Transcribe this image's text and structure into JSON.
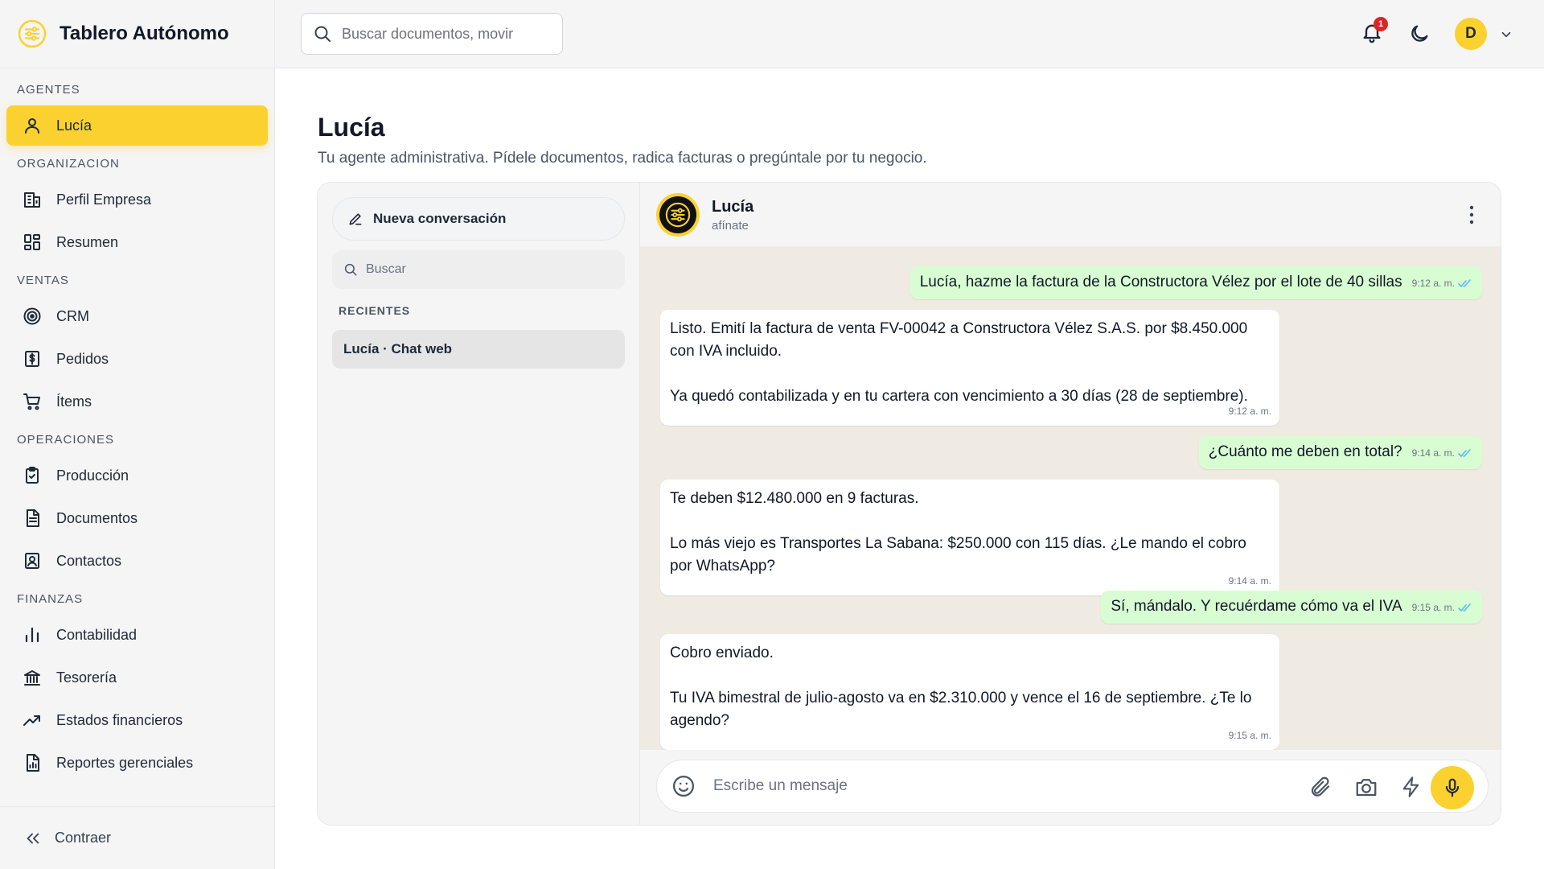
{
  "app": {
    "title": "Tablero Autónomo",
    "brand_color": "#fbd130"
  },
  "sidebar": {
    "sections": [
      {
        "label": "AGENTES"
      },
      {
        "label": "ORGANIZACION"
      },
      {
        "label": "VENTAS"
      },
      {
        "label": "OPERACIONES"
      },
      {
        "label": "FINANZAS"
      }
    ],
    "items": [
      {
        "label": "Lucía",
        "icon": "user-icon",
        "active": true
      },
      {
        "label": "Perfil Empresa",
        "icon": "building-icon"
      },
      {
        "label": "Resumen",
        "icon": "dashboard-icon"
      },
      {
        "label": "CRM",
        "icon": "target-icon"
      },
      {
        "label": "Pedidos",
        "icon": "dollar-doc-icon"
      },
      {
        "label": "Ítems",
        "icon": "cart-icon"
      },
      {
        "label": "Producción",
        "icon": "clipboard-icon"
      },
      {
        "label": "Documentos",
        "icon": "document-icon"
      },
      {
        "label": "Contactos",
        "icon": "contact-icon"
      },
      {
        "label": "Contabilidad",
        "icon": "bar-chart-icon"
      },
      {
        "label": "Tesorería",
        "icon": "bank-icon"
      },
      {
        "label": "Estados financieros",
        "icon": "trend-up-icon"
      },
      {
        "label": "Reportes gerenciales",
        "icon": "report-icon"
      }
    ],
    "collapse_label": "Contraer"
  },
  "header": {
    "search_placeholder": "Buscar documentos, movir",
    "notification_count": "1",
    "avatar_initial": "D"
  },
  "page": {
    "title": "Lucía",
    "subtitle": "Tu agente administrativa. Pídele documentos, radica facturas o pregúntale por tu negocio."
  },
  "conversations": {
    "new_label": "Nueva conversación",
    "search_placeholder": "Buscar",
    "recent_label": "RECIENTES",
    "items": [
      {
        "title": "Lucía · Chat web"
      }
    ]
  },
  "chat": {
    "name": "Lucía",
    "status": "afínate",
    "composer_placeholder": "Escribe un mensaje",
    "messages": [
      {
        "dir": "out",
        "text": "Lucía, hazme la factura de la Constructora Vélez por el lote de 40 sillas",
        "time": "9:12 a. m."
      },
      {
        "dir": "in",
        "text": "Listo. Emití la factura de venta FV-00042 a Constructora Vélez S.A.S. por $8.450.000\ncon IVA incluido.\n\nYa quedó contabilizada y en tu cartera con vencimiento a 30 días (28 de septiembre).",
        "time": "9:12 a. m."
      },
      {
        "dir": "out",
        "text": "¿Cuánto me deben en total?",
        "time": "9:14 a. m."
      },
      {
        "dir": "in",
        "text": "Te deben $12.480.000 en 9 facturas.\n\nLo más viejo es Transportes La Sabana: $250.000 con 115 días. ¿Le mando el cobro\npor WhatsApp?",
        "time": "9:14 a. m."
      },
      {
        "dir": "out",
        "text": "Sí, mándalo. Y recuérdame cómo va el IVA",
        "time": "9:15 a. m."
      },
      {
        "dir": "in",
        "text": "Cobro enviado.\n\nTu IVA bimestral de julio-agosto va en $2.310.000 y vence el 16 de septiembre. ¿Te lo\nagendo?",
        "time": "9:15 a. m."
      }
    ]
  }
}
